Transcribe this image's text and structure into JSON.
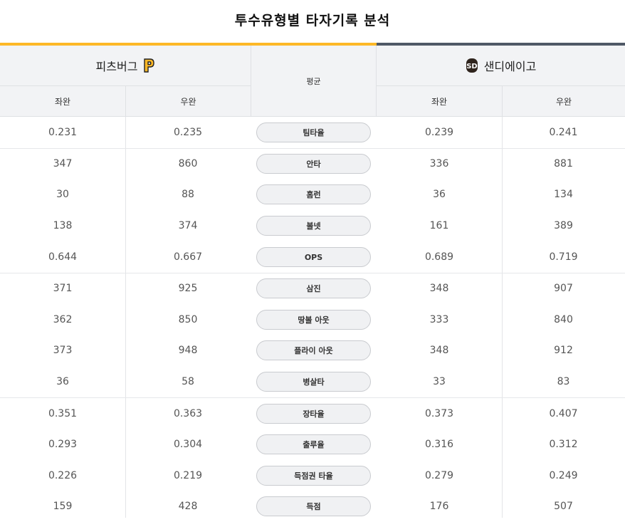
{
  "title": "투수유형별 타자기록 분석",
  "teams": {
    "left": {
      "name": "피츠버그",
      "logo_icon": "pittsburgh-p-logo",
      "color": "#fdb827"
    },
    "right": {
      "name": "샌디에이고",
      "logo_icon": "san-diego-sd-logo",
      "color": "#4f5966"
    }
  },
  "header": {
    "avg_label": "평균",
    "left_sub": [
      "좌완",
      "우완"
    ],
    "right_sub": [
      "좌완",
      "우완"
    ]
  },
  "rows": [
    {
      "stat": "팀타율",
      "left_lhp": "0.231",
      "left_rhp": "0.235",
      "right_lhp": "0.239",
      "right_rhp": "0.241",
      "sep": false
    },
    {
      "stat": "안타",
      "left_lhp": "347",
      "left_rhp": "860",
      "right_lhp": "336",
      "right_rhp": "881",
      "sep": true
    },
    {
      "stat": "홈런",
      "left_lhp": "30",
      "left_rhp": "88",
      "right_lhp": "36",
      "right_rhp": "134",
      "sep": false
    },
    {
      "stat": "볼넷",
      "left_lhp": "138",
      "left_rhp": "374",
      "right_lhp": "161",
      "right_rhp": "389",
      "sep": false
    },
    {
      "stat": "OPS",
      "left_lhp": "0.644",
      "left_rhp": "0.667",
      "right_lhp": "0.689",
      "right_rhp": "0.719",
      "sep": false
    },
    {
      "stat": "삼진",
      "left_lhp": "371",
      "left_rhp": "925",
      "right_lhp": "348",
      "right_rhp": "907",
      "sep": true
    },
    {
      "stat": "땅볼 아웃",
      "left_lhp": "362",
      "left_rhp": "850",
      "right_lhp": "333",
      "right_rhp": "840",
      "sep": false
    },
    {
      "stat": "플라이 아웃",
      "left_lhp": "373",
      "left_rhp": "948",
      "right_lhp": "348",
      "right_rhp": "912",
      "sep": false
    },
    {
      "stat": "병살타",
      "left_lhp": "36",
      "left_rhp": "58",
      "right_lhp": "33",
      "right_rhp": "83",
      "sep": false
    },
    {
      "stat": "장타율",
      "left_lhp": "0.351",
      "left_rhp": "0.363",
      "right_lhp": "0.373",
      "right_rhp": "0.407",
      "sep": true
    },
    {
      "stat": "출루율",
      "left_lhp": "0.293",
      "left_rhp": "0.304",
      "right_lhp": "0.316",
      "right_rhp": "0.312",
      "sep": false
    },
    {
      "stat": "득점권 타율",
      "left_lhp": "0.226",
      "left_rhp": "0.219",
      "right_lhp": "0.279",
      "right_rhp": "0.249",
      "sep": false
    },
    {
      "stat": "득점",
      "left_lhp": "159",
      "left_rhp": "428",
      "right_lhp": "176",
      "right_rhp": "507",
      "sep": false
    }
  ]
}
